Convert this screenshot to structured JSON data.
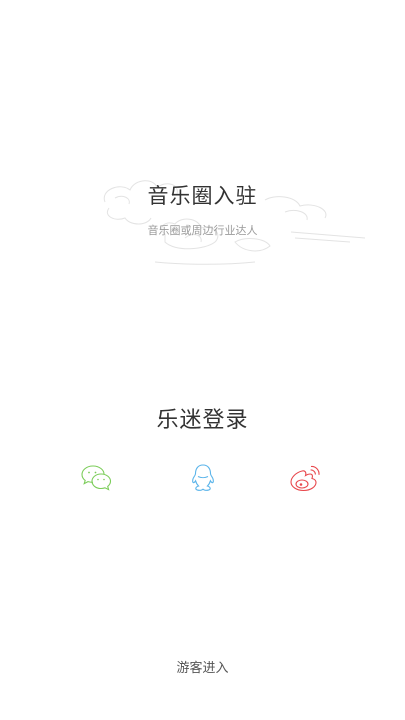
{
  "artist_section": {
    "title": "音乐圈入驻",
    "subtitle": "音乐圈或周边行业达人"
  },
  "fan_section": {
    "title": "乐迷登录",
    "login_icons": [
      {
        "name": "wechat-icon",
        "color": "#7ccd5a"
      },
      {
        "name": "qq-icon",
        "color": "#5ab4ea"
      },
      {
        "name": "weibo-icon",
        "color": "#e8474c"
      }
    ]
  },
  "guest_entry": {
    "label": "游客进入"
  }
}
